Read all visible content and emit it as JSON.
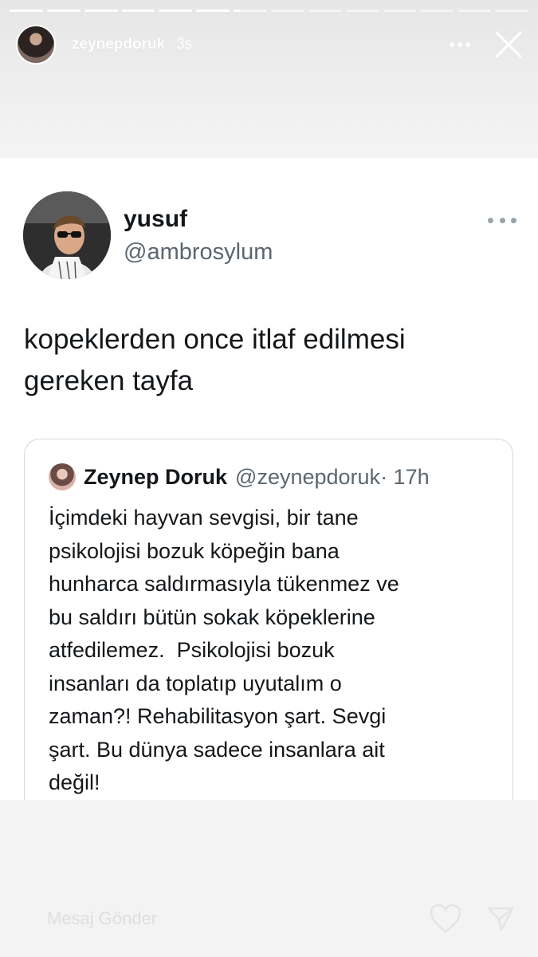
{
  "story": {
    "segments_total": 14,
    "segments_done": 6,
    "current_progress": 0.2
  },
  "header": {
    "username": "zeynepdoruk",
    "time": "3s"
  },
  "tweet": {
    "name": "yusuf",
    "handle": "@ambrosylum",
    "text_line1": "kopeklerden once itlaf edilmesi",
    "text_line2": "gereken tayfa",
    "quote": {
      "name": "Zeynep Doruk",
      "handle": "@zeynepdoruk",
      "time": "· 17h",
      "lines": [
        "İçimdeki hayvan sevgisi, bir tane",
        "psikolojisi bozuk köpeğin bana",
        "hunharca saldırmasıyla tükenmez ve",
        "bu saldırı bütün sokak köpeklerine",
        "atfedilemez.  Psikolojisi bozuk",
        "insanları da toplatıp uyutalım o",
        "zaman?! Rehabilitasyon şart. Sevgi",
        "şart. Bu dünya sadece insanlara ait",
        "değil!"
      ]
    }
  },
  "reply": {
    "placeholder": "Mesaj Gönder"
  },
  "colors": {
    "tweet_text": "#14171a",
    "muted": "#5b6670",
    "border": "#cfd9de"
  }
}
